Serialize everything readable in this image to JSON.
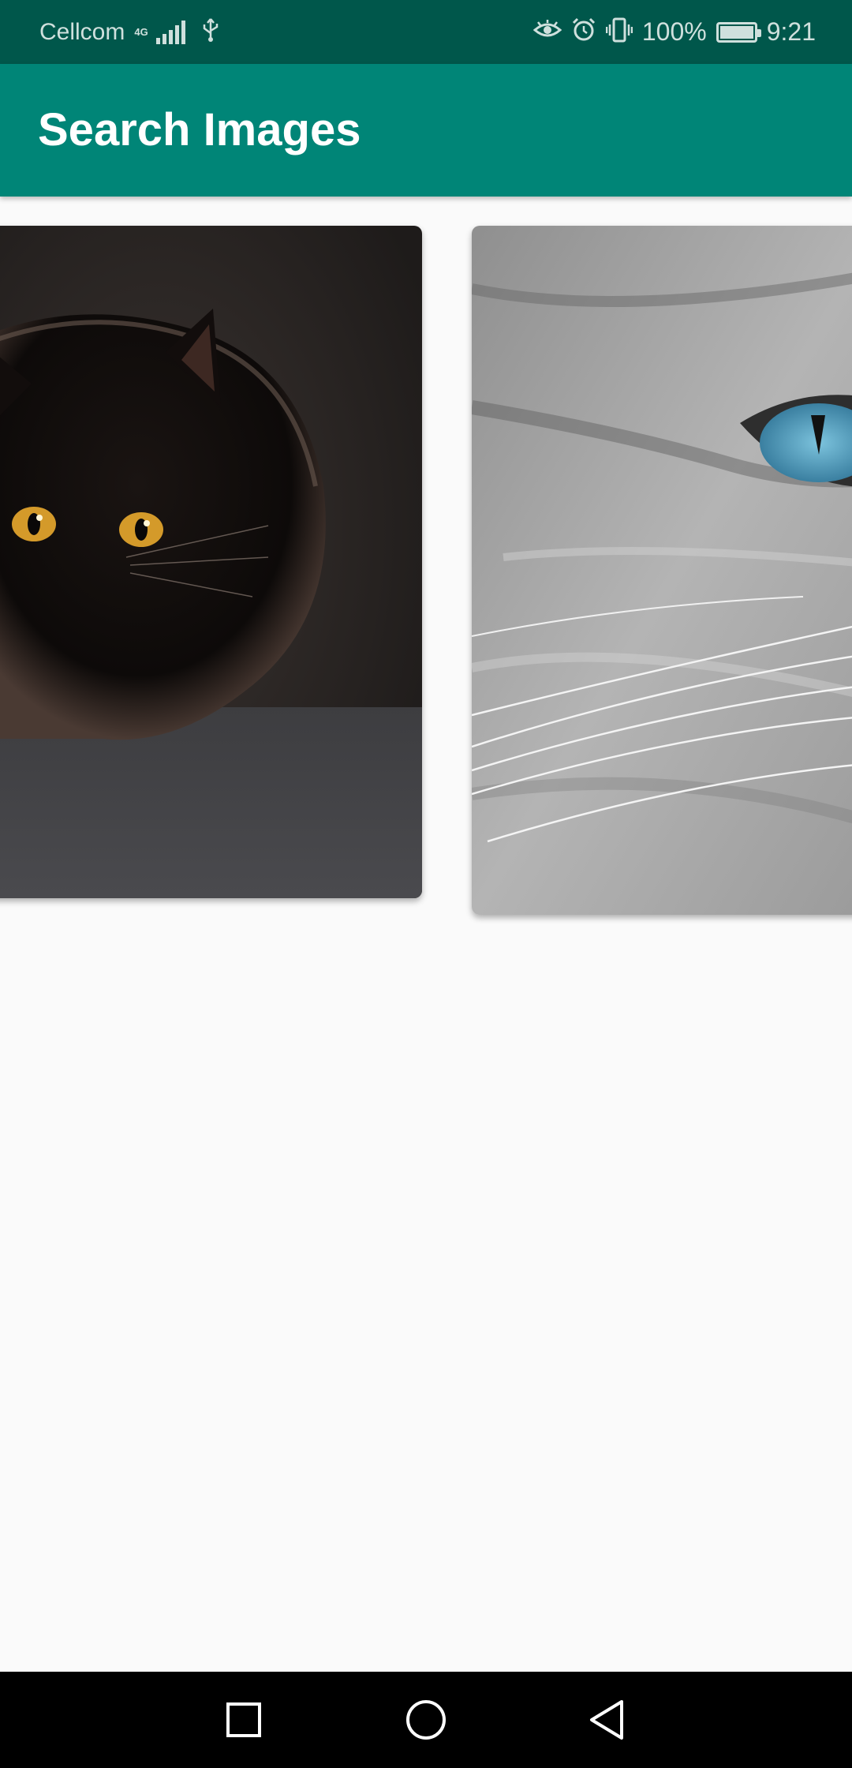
{
  "status_bar": {
    "carrier": "Cellcom",
    "network_type": "4G",
    "battery_percent": "100%",
    "time": "9:21",
    "icons": [
      "signal-icon",
      "usb-icon",
      "eye-comfort-icon",
      "alarm-icon",
      "vibrate-icon",
      "battery-icon"
    ]
  },
  "app_bar": {
    "title": "Search Images",
    "background": "#008577"
  },
  "results": {
    "images": [
      {
        "subject": "black cat with yellow eyes"
      },
      {
        "subject": "grey cat close-up with blue eye"
      }
    ]
  },
  "nav_bar": {
    "buttons": [
      "recent-apps",
      "home",
      "back"
    ]
  }
}
